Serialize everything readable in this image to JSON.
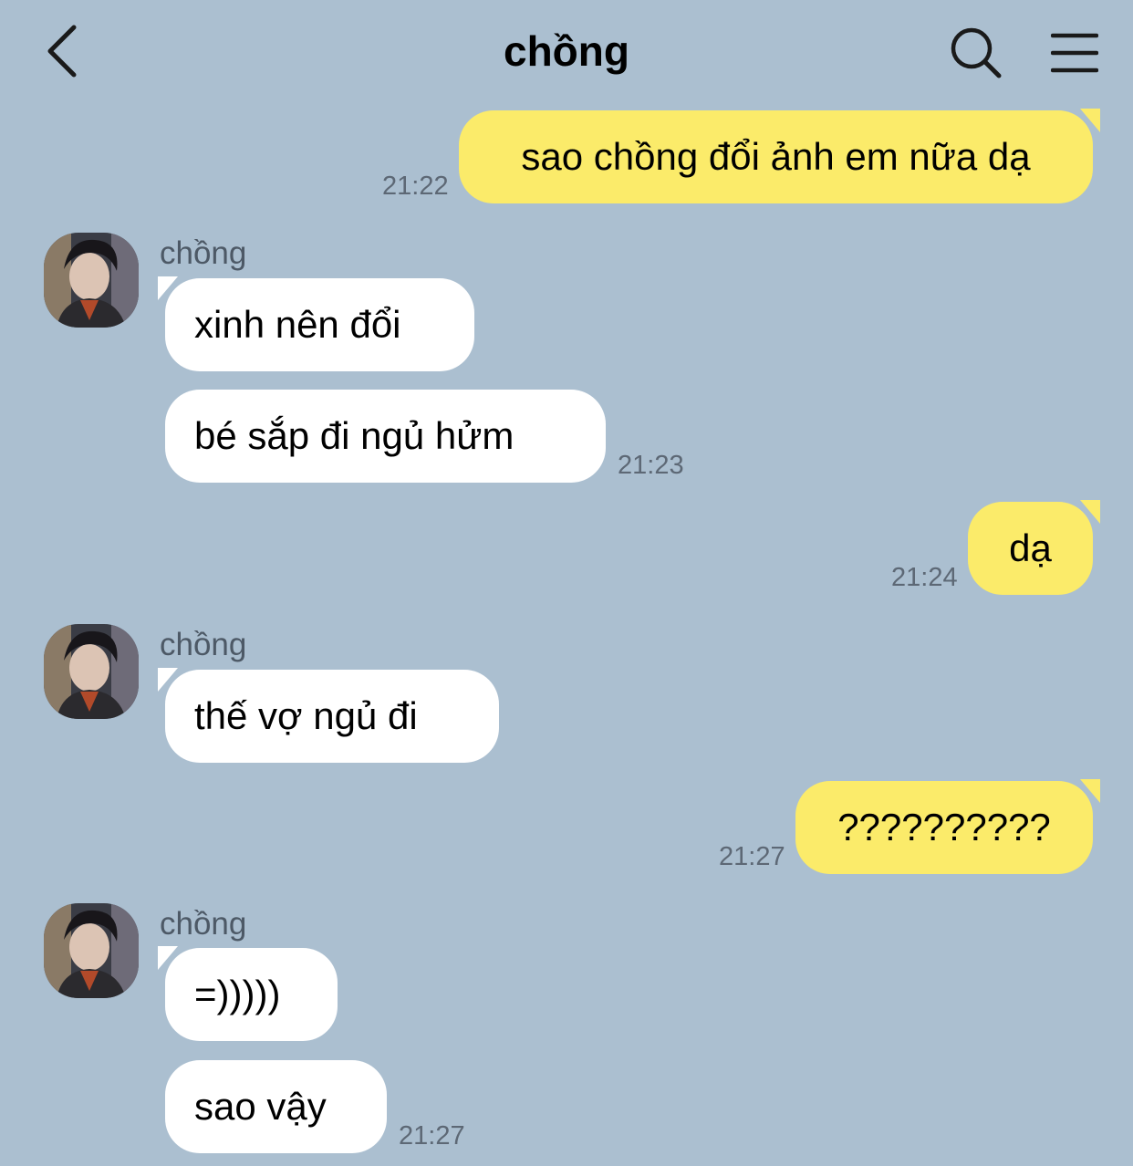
{
  "header": {
    "title": "chồng"
  },
  "messages": {
    "m1": {
      "text": "sao chồng đổi ảnh em nữa dạ",
      "time": "21:22"
    },
    "g1": {
      "sender": "chồng",
      "m1": {
        "text": "xinh nên đổi"
      },
      "m2": {
        "text": "bé sắp đi ngủ hửm",
        "time": "21:23"
      }
    },
    "m2": {
      "text": "dạ",
      "time": "21:24"
    },
    "g2": {
      "sender": "chồng",
      "m1": {
        "text": "thế vợ ngủ đi"
      }
    },
    "m3": {
      "text": "??????????",
      "time": "21:27"
    },
    "g3": {
      "sender": "chồng",
      "m1": {
        "text": "=)))))"
      },
      "m2": {
        "text": "sao vậy",
        "time": "21:27"
      }
    }
  },
  "colors": {
    "background": "#abbfd0",
    "my_bubble": "#fbeb6a",
    "their_bubble": "#ffffff"
  },
  "icons": {
    "back": "chevron-left-icon",
    "search": "search-icon",
    "menu": "menu-icon"
  }
}
